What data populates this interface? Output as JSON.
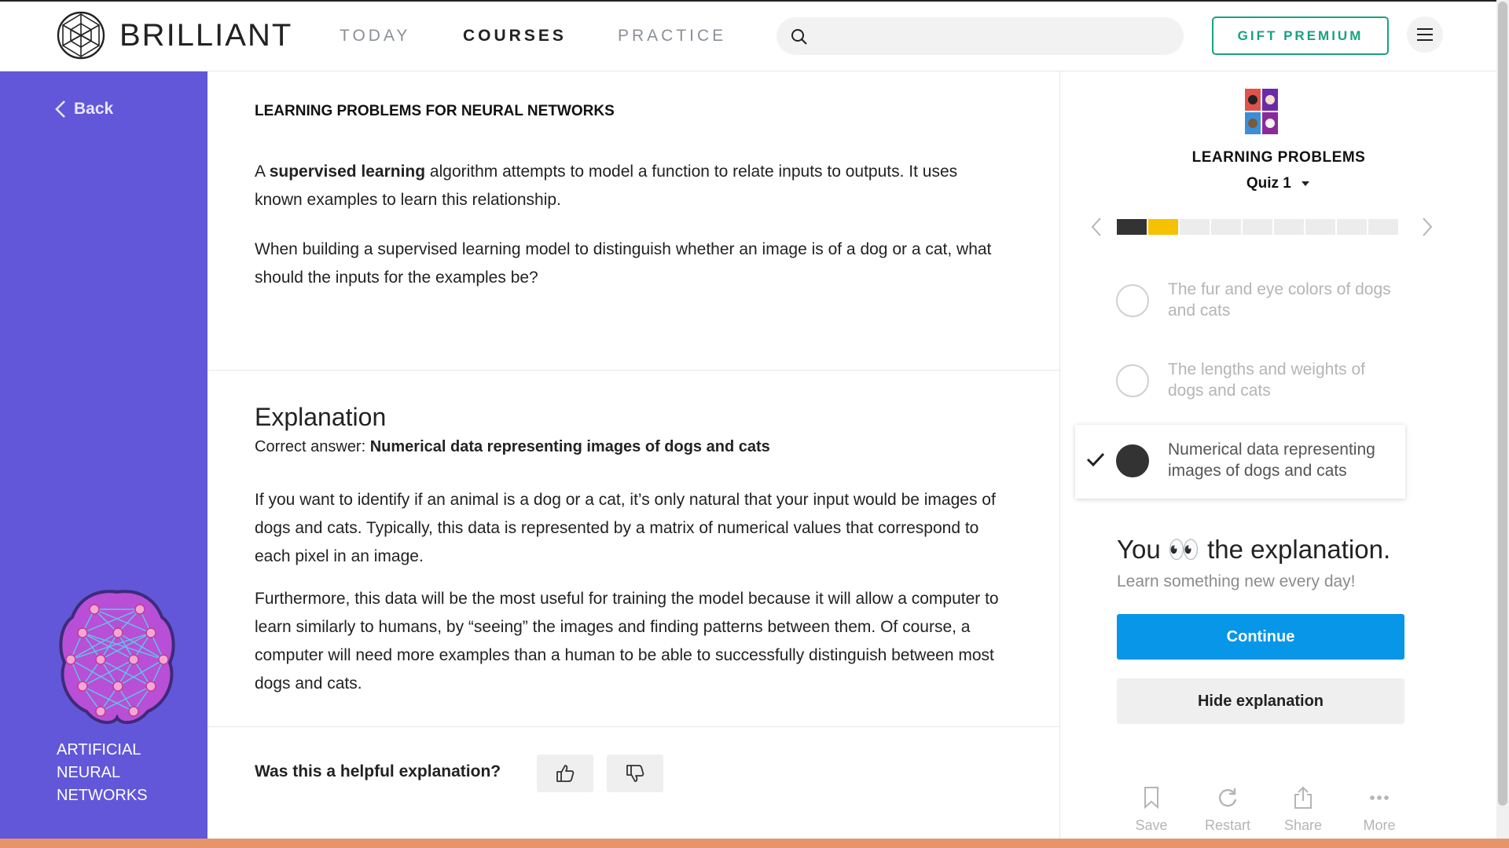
{
  "header": {
    "logo_text": "BRILLIANT",
    "nav": [
      "TODAY",
      "COURSES",
      "PRACTICE"
    ],
    "active_nav": "COURSES",
    "search_placeholder": "",
    "gift_label": "GIFT PREMIUM"
  },
  "sidebar": {
    "back_label": "Back",
    "course_name": "ARTIFICIAL NEURAL NETWORKS"
  },
  "main": {
    "section_title": "LEARNING PROBLEMS FOR NEURAL NETWORKS",
    "intro_pre": "A ",
    "intro_bold": "supervised learning",
    "intro_post": " algorithm attempts to model a function to relate inputs to outputs. It uses known examples to learn this relationship.",
    "question": "When building a supervised learning model to distinguish whether an image is of a dog or a cat, what should the inputs for the examples be?",
    "explanation_title": "Explanation",
    "correct_prefix": "Correct answer: ",
    "correct_answer": "Numerical data representing images of dogs and cats",
    "explanation_p1": "If you want to identify if an animal is a dog or a cat, it’s only natural that your input would be images of dogs and cats. Typically, this data is represented by a matrix of numerical values that correspond to each pixel in an image.",
    "explanation_p2": "Furthermore, this data will be the most useful for training the model because it will allow a computer to learn similarly to humans, by “seeing” the images and finding patterns between them. Of course, a computer will need more examples than a human to be able to successfully distinguish between most dogs and cats.",
    "helpful_question": "Was this a helpful explanation?"
  },
  "right_panel": {
    "title": "LEARNING PROBLEMS",
    "quiz_label": "Quiz 1",
    "progress": {
      "total": 9,
      "completed": 1,
      "current": 2
    },
    "progress_colors": {
      "completed": "#333333",
      "current": "#f5c100",
      "pending": "#ececec"
    },
    "options": [
      {
        "label": "The fur and eye colors of dogs and cats",
        "selected": false
      },
      {
        "label": "The lengths and weights of dogs and cats",
        "selected": false
      },
      {
        "label": "Numerical data representing images of dogs and cats",
        "selected": true
      }
    ],
    "you_pre": "You ",
    "you_emoji": "👀",
    "you_post": " the explanation.",
    "learn_sub": "Learn something new every day!",
    "continue_label": "Continue",
    "hide_label": "Hide explanation",
    "actions": [
      "Save",
      "Restart",
      "Share",
      "More"
    ]
  },
  "colors": {
    "sidebar": "#6257d9",
    "accent_green": "#1aa181",
    "continue_blue": "#0896e8",
    "bottom_stripe": "#e8946b"
  }
}
